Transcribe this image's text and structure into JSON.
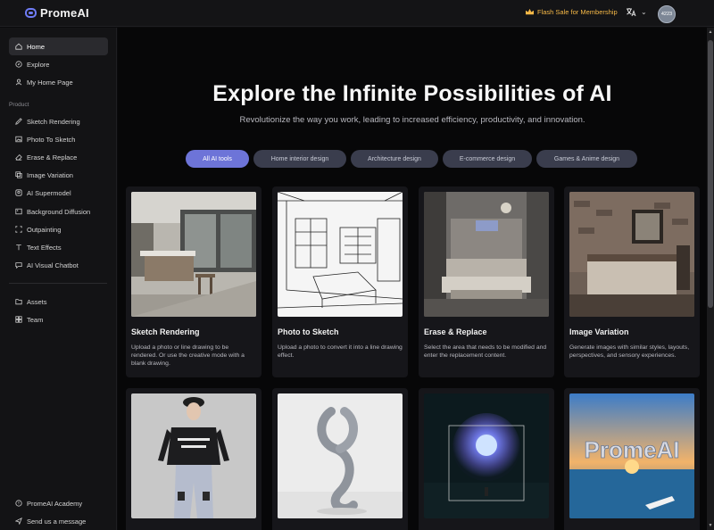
{
  "app": {
    "name": "PromeAI"
  },
  "topbar": {
    "flash_sale": "Flash Sale for Membership",
    "avatar_text": "4223"
  },
  "sidebar": {
    "top_items": [
      {
        "label": "Home",
        "icon": "home-icon",
        "active": true
      },
      {
        "label": "Explore",
        "icon": "compass-icon"
      },
      {
        "label": "My Home Page",
        "icon": "user-icon"
      }
    ],
    "section_label": "Product",
    "product_items": [
      {
        "label": "Sketch Rendering",
        "icon": "sketch-icon"
      },
      {
        "label": "Photo To Sketch",
        "icon": "photo-icon"
      },
      {
        "label": "Erase & Replace",
        "icon": "eraser-icon"
      },
      {
        "label": "Image Variation",
        "icon": "variation-icon"
      },
      {
        "label": "AI Supermodel",
        "icon": "model-icon"
      },
      {
        "label": "Background Diffusion",
        "icon": "background-icon"
      },
      {
        "label": "Outpainting",
        "icon": "outpaint-icon"
      },
      {
        "label": "Text Effects",
        "icon": "text-icon"
      },
      {
        "label": "AI Visual Chatbot",
        "icon": "chat-icon"
      }
    ],
    "bottom_items": [
      {
        "label": "Assets",
        "icon": "folder-icon"
      },
      {
        "label": "Team",
        "icon": "team-icon"
      }
    ],
    "footer_items": [
      {
        "label": "PromeAI Academy",
        "icon": "academy-icon"
      },
      {
        "label": "Send us a message",
        "icon": "send-icon"
      }
    ]
  },
  "hero": {
    "title": "Explore the Infinite Possibilities of AI",
    "subtitle": "Revolutionize the way you work, leading to increased efficiency, productivity, and innovation."
  },
  "filters": [
    {
      "label": "All AI tools",
      "active": true
    },
    {
      "label": "Home interior design"
    },
    {
      "label": "Architecture design"
    },
    {
      "label": "E-commerce design"
    },
    {
      "label": "Games & Anime design"
    }
  ],
  "cards": [
    {
      "title": "Sketch Rendering",
      "description": "Upload a photo or line drawing to be rendered. Or use the creative mode with a blank drawing."
    },
    {
      "title": "Photo to Sketch",
      "description": "Upload a photo to convert it into a line drawing effect."
    },
    {
      "title": "Erase & Replace",
      "description": "Select the area that needs to be modified and enter the replacement content."
    },
    {
      "title": "Image Variation",
      "description": "Generate images with similar styles, layouts, perspectives, and sensory experiences."
    },
    {
      "title": "",
      "description": ""
    },
    {
      "title": "",
      "description": ""
    },
    {
      "title": "",
      "description": ""
    },
    {
      "title": "",
      "description": ""
    }
  ],
  "watermark_text": "PromeAI",
  "colors": {
    "accent": "#6d74d8",
    "flash": "#f5b847",
    "bg": "#070708"
  }
}
